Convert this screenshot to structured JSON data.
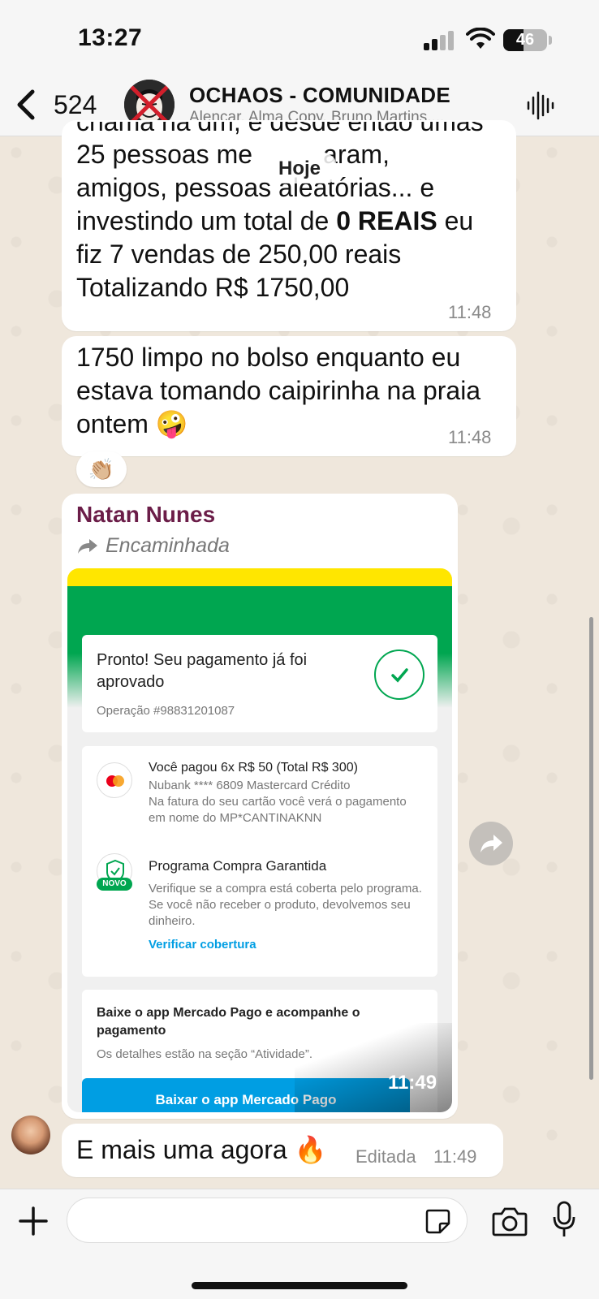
{
  "status_bar": {
    "time": "13:27",
    "battery": "46"
  },
  "header": {
    "back_count": "524",
    "group_name": "OCHAOS - COMUNIDADE",
    "members": "Alencar, Alma Copy, Bruno Martins,..."
  },
  "date_chip": "Hoje",
  "messages": [
    {
      "line0": "chama na dm, e desde então umas",
      "line1a": "25 pessoas me ",
      "line1b": "aram,",
      "line2": "amigos, pessoas aleatórias... e",
      "line3a": "investindo um total de ",
      "line3bold": "0 REAIS",
      "line3b": " eu",
      "line4": "fiz 7 vendas de 250,00 reais",
      "line5": "Totalizando R$ 1750,00",
      "time": "11:48"
    },
    {
      "line1": "1750 limpo no bolso enquanto eu",
      "line2": "estava tomando caipirinha na praia",
      "line3": "ontem 🤪",
      "time": "11:48",
      "reaction": "👏🏼"
    },
    {
      "sender": "Natan Nunes",
      "forwarded": "Encaminhada",
      "time": "11:49"
    },
    {
      "text": "E mais uma agora 🔥",
      "edited": "Editada",
      "time": "11:49"
    }
  ],
  "receipt": {
    "approved_title": "Pronto! Seu pagamento já foi aprovado",
    "operation": "Operação #98831201087",
    "paid": "Você pagou 6x R$ 50 (Total R$ 300)",
    "card": "Nubank **** 6809 Mastercard Crédito",
    "invoice_note": "Na fatura do seu cartão você verá o pagamento em nome do MP*CANTINAKNN",
    "program_title": "Programa Compra Garantida",
    "novo_badge": "NOVO",
    "program_desc": "Verifique se a compra está coberta pelo programa. Se você não receber o produto, devolvemos seu dinheiro.",
    "verify_link": "Verificar cobertura",
    "app_title": "Baixe o app Mercado Pago e acompanhe o pagamento",
    "app_desc": "Os detalhes estão na seção “Atividade”.",
    "app_button": "Baixar o app Mercado Pago"
  },
  "input": {
    "placeholder": ""
  },
  "colors": {
    "sender_name": "#6b1d48",
    "mp_green": "#00a650",
    "mp_blue": "#009ee3",
    "mp_yellow": "#ffe600"
  }
}
